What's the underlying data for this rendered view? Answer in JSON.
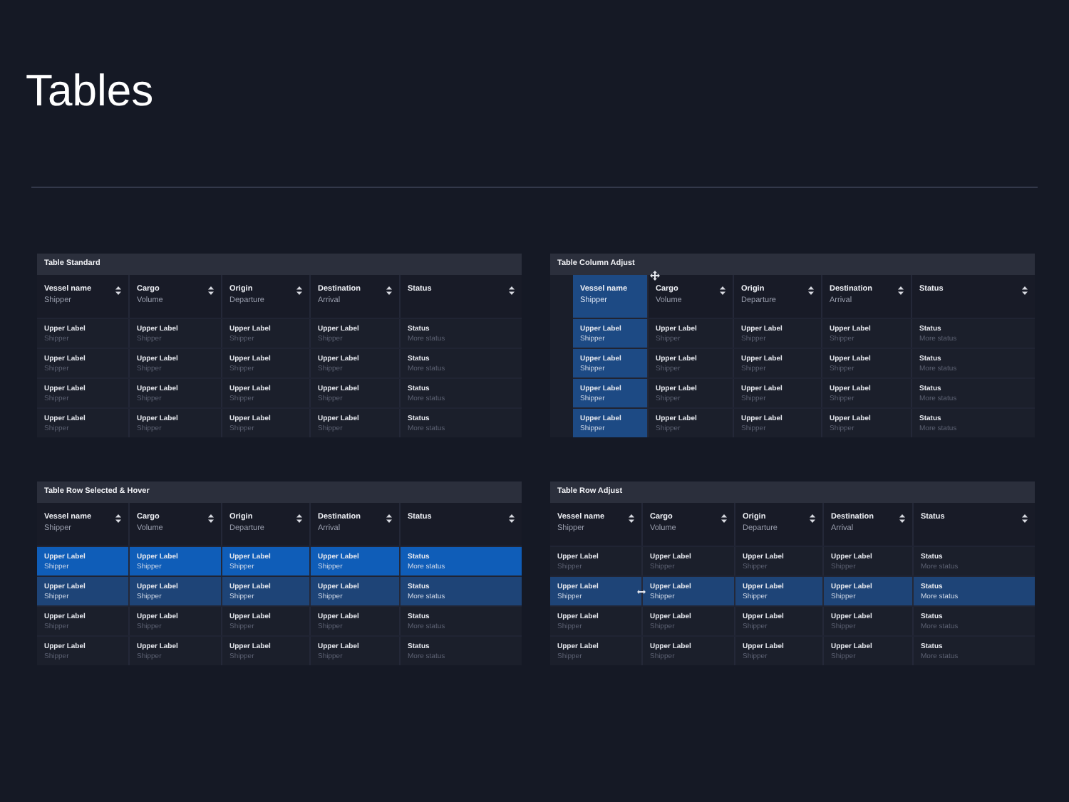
{
  "page_title": "Tables",
  "tables": [
    {
      "title": "Table Standard",
      "columns": [
        {
          "label": "Vessel name",
          "sublabel": "Shipper"
        },
        {
          "label": "Cargo",
          "sublabel": "Volume"
        },
        {
          "label": "Origin",
          "sublabel": "Departure"
        },
        {
          "label": "Destination",
          "sublabel": "Arrival"
        },
        {
          "label": "Status"
        }
      ],
      "rows": [
        {
          "cells": [
            {
              "upper": "Upper Label",
              "lower": "Shipper"
            },
            {
              "upper": "Upper Label",
              "lower": "Shipper"
            },
            {
              "upper": "Upper Label",
              "lower": "Shipper"
            },
            {
              "upper": "Upper Label",
              "lower": "Shipper"
            },
            {
              "upper": "Status",
              "lower": "More status"
            }
          ]
        },
        {
          "cells": [
            {
              "upper": "Upper Label",
              "lower": "Shipper"
            },
            {
              "upper": "Upper Label",
              "lower": "Shipper"
            },
            {
              "upper": "Upper Label",
              "lower": "Shipper"
            },
            {
              "upper": "Upper Label",
              "lower": "Shipper"
            },
            {
              "upper": "Status",
              "lower": "More status"
            }
          ]
        },
        {
          "cells": [
            {
              "upper": "Upper Label",
              "lower": "Shipper"
            },
            {
              "upper": "Upper Label",
              "lower": "Shipper"
            },
            {
              "upper": "Upper Label",
              "lower": "Shipper"
            },
            {
              "upper": "Upper Label",
              "lower": "Shipper"
            },
            {
              "upper": "Status",
              "lower": "More status"
            }
          ]
        },
        {
          "cells": [
            {
              "upper": "Upper Label",
              "lower": "Shipper"
            },
            {
              "upper": "Upper Label",
              "lower": "Shipper"
            },
            {
              "upper": "Upper Label",
              "lower": "Shipper"
            },
            {
              "upper": "Upper Label",
              "lower": "Shipper"
            },
            {
              "upper": "Status",
              "lower": "More status"
            }
          ]
        }
      ]
    },
    {
      "title": "Table Column Adjust",
      "columns": [
        {
          "label": "Vessel name",
          "sublabel": "Shipper",
          "dragging": true
        },
        {
          "label": "Cargo",
          "sublabel": "Volume",
          "dragging": false
        },
        {
          "label": "Origin",
          "sublabel": "Departure",
          "dragging": false
        },
        {
          "label": "Destination",
          "sublabel": "Arrival",
          "dragging": false
        },
        {
          "label": "Status",
          "dragging": false
        }
      ],
      "rows": [
        {
          "cells": [
            {
              "upper": "Upper Label",
              "lower": "Shipper"
            },
            {
              "upper": "Upper Label",
              "lower": "Shipper"
            },
            {
              "upper": "Upper Label",
              "lower": "Shipper"
            },
            {
              "upper": "Upper Label",
              "lower": "Shipper"
            },
            {
              "upper": "Status",
              "lower": "More status"
            }
          ]
        },
        {
          "cells": [
            {
              "upper": "Upper Label",
              "lower": "Shipper"
            },
            {
              "upper": "Upper Label",
              "lower": "Shipper"
            },
            {
              "upper": "Upper Label",
              "lower": "Shipper"
            },
            {
              "upper": "Upper Label",
              "lower": "Shipper"
            },
            {
              "upper": "Status",
              "lower": "More status"
            }
          ]
        },
        {
          "cells": [
            {
              "upper": "Upper Label",
              "lower": "Shipper"
            },
            {
              "upper": "Upper Label",
              "lower": "Shipper"
            },
            {
              "upper": "Upper Label",
              "lower": "Shipper"
            },
            {
              "upper": "Upper Label",
              "lower": "Shipper"
            },
            {
              "upper": "Status",
              "lower": "More status"
            }
          ]
        },
        {
          "cells": [
            {
              "upper": "Upper Label",
              "lower": "Shipper"
            },
            {
              "upper": "Upper Label",
              "lower": "Shipper"
            },
            {
              "upper": "Upper Label",
              "lower": "Shipper"
            },
            {
              "upper": "Upper Label",
              "lower": "Shipper"
            },
            {
              "upper": "Status",
              "lower": "More status"
            }
          ]
        }
      ]
    },
    {
      "title": "Table Row Selected & Hover",
      "columns": [
        {
          "label": "Vessel name",
          "sublabel": "Shipper"
        },
        {
          "label": "Cargo",
          "sublabel": "Volume"
        },
        {
          "label": "Origin",
          "sublabel": "Departure"
        },
        {
          "label": "Destination",
          "sublabel": "Arrival"
        },
        {
          "label": "Status"
        }
      ],
      "rows": [
        {
          "selected": true,
          "hover": false,
          "cells": [
            {
              "upper": "Upper Label",
              "lower": "Shipper"
            },
            {
              "upper": "Upper Label",
              "lower": "Shipper"
            },
            {
              "upper": "Upper Label",
              "lower": "Shipper"
            },
            {
              "upper": "Upper Label",
              "lower": "Shipper"
            },
            {
              "upper": "Status",
              "lower": "More status"
            }
          ]
        },
        {
          "selected": false,
          "hover": true,
          "cells": [
            {
              "upper": "Upper Label",
              "lower": "Shipper"
            },
            {
              "upper": "Upper Label",
              "lower": "Shipper"
            },
            {
              "upper": "Upper Label",
              "lower": "Shipper"
            },
            {
              "upper": "Upper Label",
              "lower": "Shipper"
            },
            {
              "upper": "Status",
              "lower": "More status"
            }
          ]
        },
        {
          "selected": false,
          "hover": false,
          "cells": [
            {
              "upper": "Upper Label",
              "lower": "Shipper"
            },
            {
              "upper": "Upper Label",
              "lower": "Shipper"
            },
            {
              "upper": "Upper Label",
              "lower": "Shipper"
            },
            {
              "upper": "Upper Label",
              "lower": "Shipper"
            },
            {
              "upper": "Status",
              "lower": "More status"
            }
          ]
        },
        {
          "selected": false,
          "hover": false,
          "cells": [
            {
              "upper": "Upper Label",
              "lower": "Shipper"
            },
            {
              "upper": "Upper Label",
              "lower": "Shipper"
            },
            {
              "upper": "Upper Label",
              "lower": "Shipper"
            },
            {
              "upper": "Upper Label",
              "lower": "Shipper"
            },
            {
              "upper": "Status",
              "lower": "More status"
            }
          ]
        }
      ]
    },
    {
      "title": "Table Row Adjust",
      "columns": [
        {
          "label": "Vessel name",
          "sublabel": "Shipper"
        },
        {
          "label": "Cargo",
          "sublabel": "Volume"
        },
        {
          "label": "Origin",
          "sublabel": "Departure"
        },
        {
          "label": "Destination",
          "sublabel": "Arrival"
        },
        {
          "label": "Status"
        }
      ],
      "rows": [
        {
          "resizing": false,
          "cells": [
            {
              "upper": "Upper Label",
              "lower": "Shipper"
            },
            {
              "upper": "Upper Label",
              "lower": "Shipper"
            },
            {
              "upper": "Upper Label",
              "lower": "Shipper"
            },
            {
              "upper": "Upper Label",
              "lower": "Shipper"
            },
            {
              "upper": "Status",
              "lower": "More status"
            }
          ]
        },
        {
          "resizing": true,
          "cells": [
            {
              "upper": "Upper Label",
              "lower": "Shipper"
            },
            {
              "upper": "Upper Label",
              "lower": "Shipper"
            },
            {
              "upper": "Upper Label",
              "lower": "Shipper"
            },
            {
              "upper": "Upper Label",
              "lower": "Shipper"
            },
            {
              "upper": "Status",
              "lower": "More status"
            }
          ]
        },
        {
          "resizing": false,
          "cells": [
            {
              "upper": "Upper Label",
              "lower": "Shipper"
            },
            {
              "upper": "Upper Label",
              "lower": "Shipper"
            },
            {
              "upper": "Upper Label",
              "lower": "Shipper"
            },
            {
              "upper": "Upper Label",
              "lower": "Shipper"
            },
            {
              "upper": "Status",
              "lower": "More status"
            }
          ]
        },
        {
          "resizing": false,
          "cells": [
            {
              "upper": "Upper Label",
              "lower": "Shipper"
            },
            {
              "upper": "Upper Label",
              "lower": "Shipper"
            },
            {
              "upper": "Upper Label",
              "lower": "Shipper"
            },
            {
              "upper": "Upper Label",
              "lower": "Shipper"
            },
            {
              "upper": "Status",
              "lower": "More status"
            }
          ]
        }
      ]
    }
  ]
}
